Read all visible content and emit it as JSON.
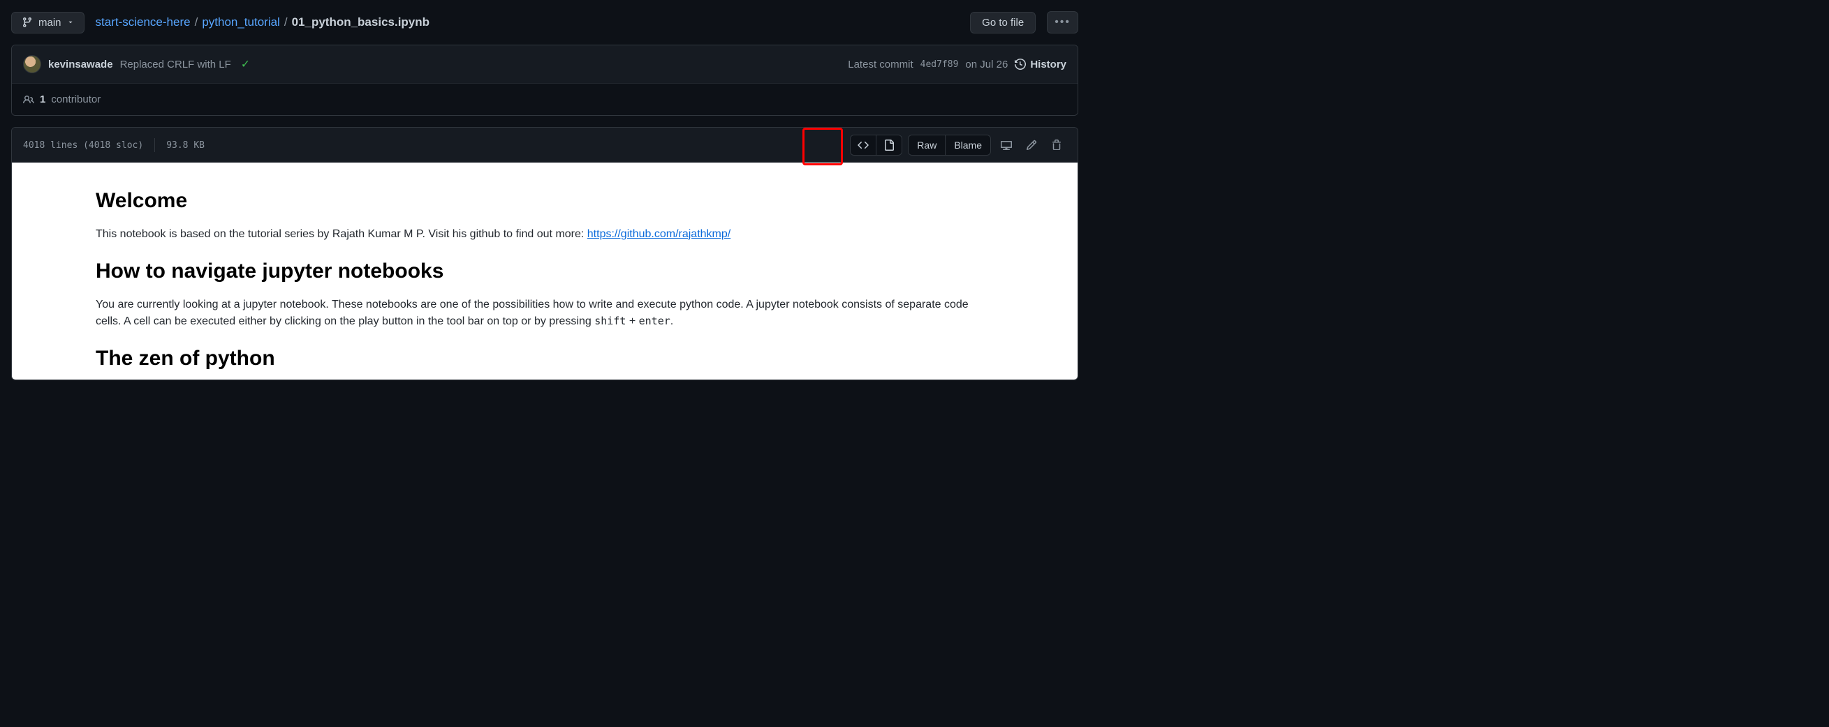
{
  "branch": {
    "name": "main"
  },
  "breadcrumb": {
    "repo": "start-science-here",
    "folder": "python_tutorial",
    "file": "01_python_basics.ipynb"
  },
  "buttons": {
    "goto_file": "Go to file",
    "raw": "Raw",
    "blame": "Blame",
    "history": "History"
  },
  "commit": {
    "author": "kevinsawade",
    "message": "Replaced CRLF with LF",
    "latest_label": "Latest commit",
    "hash": "4ed7f89",
    "date": "on Jul 26"
  },
  "contributors": {
    "count": "1",
    "label": "contributor"
  },
  "file_meta": {
    "lines": "4018 lines (4018 sloc)",
    "size": "93.8 KB"
  },
  "notebook": {
    "h1_welcome": "Welcome",
    "p1_a": "This notebook is based on the tutorial series by Rajath Kumar M P. Visit his github to find out more: ",
    "p1_link": "https://github.com/rajathkmp/",
    "h1_nav": "How to navigate jupyter notebooks",
    "p2_a": "You are currently looking at a jupyter notebook. These notebooks are one of the possibilities how to write and execute python code. A jupyter notebook consists of separate code cells. A cell can be executed either by clicking on the play button in the tool bar on top or by pressing ",
    "p2_code1": "shift",
    "p2_mid": " + ",
    "p2_code2": "enter",
    "p2_end": ".",
    "h1_zen": "The zen of python"
  }
}
